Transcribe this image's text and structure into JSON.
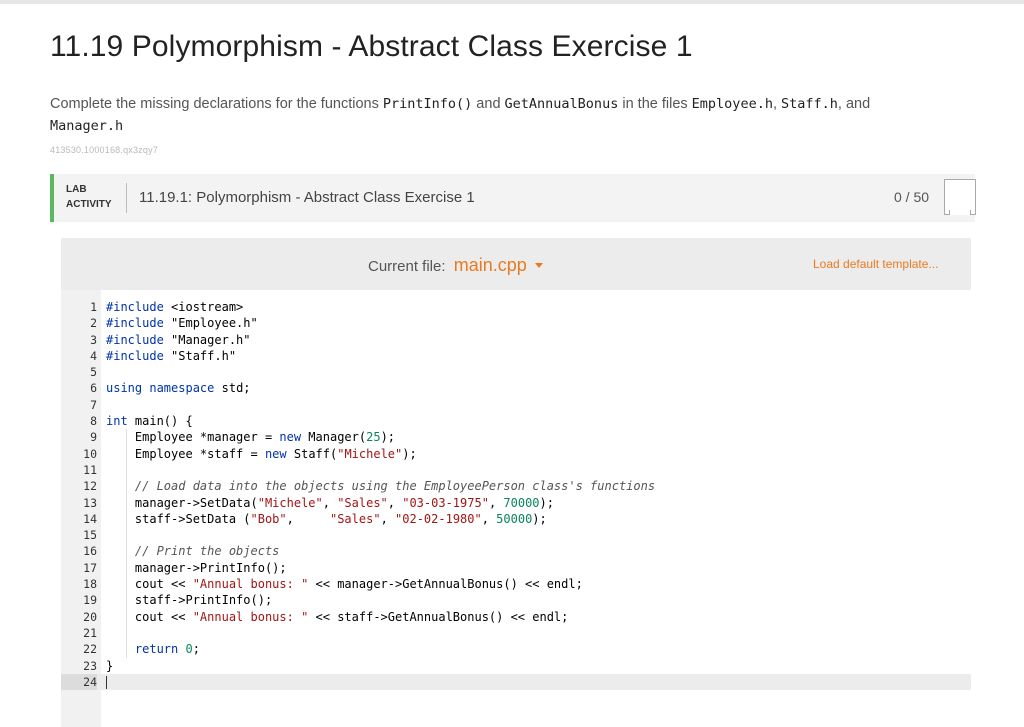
{
  "page": {
    "title": "11.19 Polymorphism - Abstract Class Exercise 1",
    "instructions": {
      "t1": "Complete the missing declarations for the functions ",
      "c1": "PrintInfo()",
      "t2": " and ",
      "c2": "GetAnnualBonus",
      "t3": " in the files ",
      "c3": "Employee.h",
      "t4": ", ",
      "c4": "Staff.h",
      "t5": ", and",
      "c5": "Manager.h"
    },
    "content_id": "413530.1000168.qx3zqy7"
  },
  "lab": {
    "tag_line1": "LAB",
    "tag_line2": "ACTIVITY",
    "title": "11.19.1: Polymorphism - Abstract Class Exercise 1",
    "score": "0 / 50"
  },
  "editor": {
    "current_file_label": "Current file:",
    "current_file": "main.cpp",
    "load_default": "Load default template...",
    "line_numbers": [
      "1",
      "2",
      "3",
      "4",
      "5",
      "6",
      "7",
      "8",
      "9",
      "10",
      "11",
      "12",
      "13",
      "14",
      "15",
      "16",
      "17",
      "18",
      "19",
      "20",
      "21",
      "22",
      "23",
      "24"
    ],
    "code": [
      "#include <iostream>",
      "#include \"Employee.h\"",
      "#include \"Manager.h\"",
      "#include \"Staff.h\"",
      "",
      "using namespace std;",
      "",
      "int main() {",
      "    Employee *manager = new Manager(25);",
      "    Employee *staff = new Staff(\"Michele\");",
      "",
      "    // Load data into the objects using the EmployeePerson class's functions",
      "    manager->SetData(\"Michele\", \"Sales\", \"03-03-1975\", 70000);",
      "    staff->SetData (\"Bob\",     \"Sales\", \"02-02-1980\", 50000);",
      "",
      "    // Print the objects",
      "    manager->PrintInfo();",
      "    cout << \"Annual bonus: \" << manager->GetAnnualBonus() << endl;",
      "    staff->PrintInfo();",
      "    cout << \"Annual bonus: \" << staff->GetAnnualBonus() << endl;",
      "",
      "    return 0;",
      "}",
      ""
    ]
  },
  "colors": {
    "accent_orange": "#e87b22",
    "lab_green": "#5cb85c"
  }
}
